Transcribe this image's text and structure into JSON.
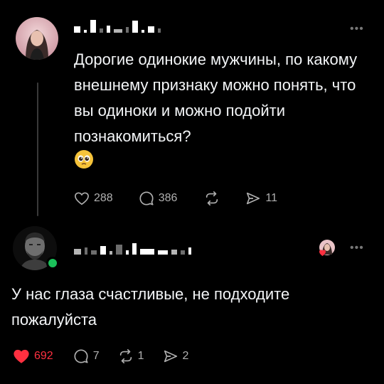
{
  "post": {
    "author_name_visible": false,
    "text": "Дорогие одинокие мужчины, по какому внешнему признаку можно понять, что вы одиноки и можно подойти познакомиться?",
    "emoji": "🥹",
    "stats": {
      "likes": "288",
      "comments": "386",
      "shares": "11"
    }
  },
  "reply": {
    "author_name_visible": false,
    "text": "У нас глаза счастливые, не подходите пожалуйста",
    "stats": {
      "likes": "692",
      "comments": "7",
      "reposts": "1",
      "shares": "2"
    },
    "liked": true,
    "online": true
  },
  "colors": {
    "background": "#000000",
    "text": "#f3f5f7",
    "muted": "#b0b0b0",
    "like_red": "#ff3040",
    "online_green": "#1bc15a"
  },
  "icons": [
    "heart-icon",
    "comment-icon",
    "repost-icon",
    "send-icon",
    "more-icon"
  ]
}
